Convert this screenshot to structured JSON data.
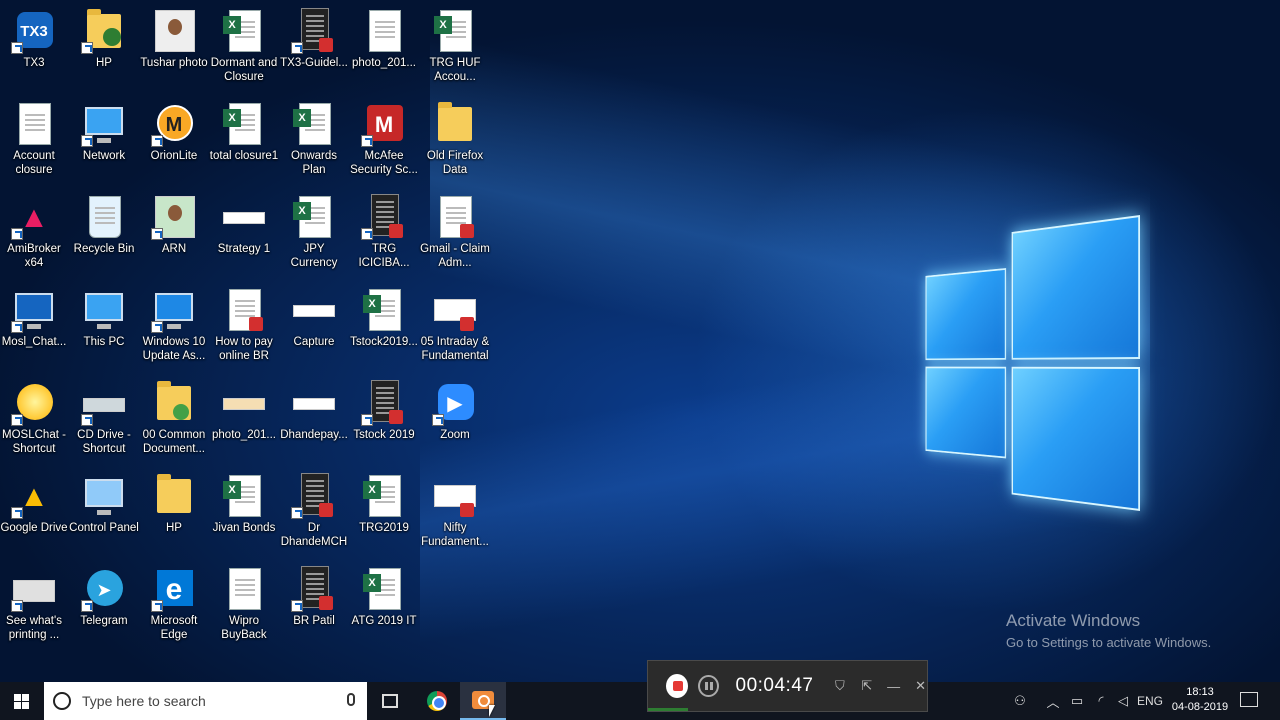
{
  "desktop": {
    "icons": [
      {
        "label": "TX3",
        "kind": "tx3"
      },
      {
        "label": "HP",
        "kind": "folder-user"
      },
      {
        "label": "Tushar photo",
        "kind": "photo"
      },
      {
        "label": "Dormant and Closure",
        "kind": "excel"
      },
      {
        "label": "TX3-Guidel...",
        "kind": "dark-pdf"
      },
      {
        "label": "photo_201...",
        "kind": "doc"
      },
      {
        "label": "TRG HUF Accou...",
        "kind": "excel"
      },
      {
        "label": "Account closure",
        "kind": "word"
      },
      {
        "label": "Network",
        "kind": "network"
      },
      {
        "label": "OrionLite",
        "kind": "orion"
      },
      {
        "label": "total closure1",
        "kind": "excel"
      },
      {
        "label": "Onwards Plan",
        "kind": "excel"
      },
      {
        "label": "McAfee Security Sc...",
        "kind": "mcafee"
      },
      {
        "label": "Old Firefox Data",
        "kind": "folder"
      },
      {
        "label": "AmiBroker x64",
        "kind": "amibroker"
      },
      {
        "label": "Recycle Bin",
        "kind": "recycle"
      },
      {
        "label": "ARN",
        "kind": "photo-green"
      },
      {
        "label": "Strategy 1",
        "kind": "strip"
      },
      {
        "label": "JPY Currency",
        "kind": "excel"
      },
      {
        "label": "TRG ICICIBA...",
        "kind": "dark-pdf"
      },
      {
        "label": "Gmail - Claim Adm...",
        "kind": "doc-pdf"
      },
      {
        "label": "Mosl_Chat...",
        "kind": "mosl"
      },
      {
        "label": "This PC",
        "kind": "pc"
      },
      {
        "label": "Windows 10 Update As...",
        "kind": "win-update"
      },
      {
        "label": "How to pay online BR",
        "kind": "doc-pdf"
      },
      {
        "label": "Capture",
        "kind": "strip"
      },
      {
        "label": "Tstock2019...",
        "kind": "excel"
      },
      {
        "label": "05 Intraday & Fundamental",
        "kind": "pdf-wide"
      },
      {
        "label": "MOSLChat - Shortcut",
        "kind": "sun"
      },
      {
        "label": "CD Drive - Shortcut",
        "kind": "drive"
      },
      {
        "label": "00 Common Document...",
        "kind": "folder-green"
      },
      {
        "label": "photo_201...",
        "kind": "strip-tan"
      },
      {
        "label": "Dhandepay...",
        "kind": "strip"
      },
      {
        "label": "Tstock 2019",
        "kind": "dark-pdf"
      },
      {
        "label": "Zoom",
        "kind": "zoom"
      },
      {
        "label": "Google Drive",
        "kind": "gdrive"
      },
      {
        "label": "Control Panel",
        "kind": "control"
      },
      {
        "label": "HP",
        "kind": "folder"
      },
      {
        "label": "Jivan Bonds",
        "kind": "excel"
      },
      {
        "label": "Dr DhandeMCH",
        "kind": "dark-pdf"
      },
      {
        "label": "TRG2019",
        "kind": "excel"
      },
      {
        "label": "Nifty Fundament...",
        "kind": "pdf-wide"
      },
      {
        "label": "See what's printing ...",
        "kind": "printer"
      },
      {
        "label": "Telegram",
        "kind": "telegram"
      },
      {
        "label": "Microsoft Edge",
        "kind": "edge"
      },
      {
        "label": "Wipro BuyBack",
        "kind": "word"
      },
      {
        "label": "BR Patil",
        "kind": "dark-pdf"
      },
      {
        "label": "ATG 2019 IT",
        "kind": "excel"
      }
    ]
  },
  "watermark": {
    "title": "Activate Windows",
    "subtitle": "Go to Settings to activate Windows."
  },
  "recorder": {
    "timer": "00:04:47"
  },
  "taskbar": {
    "search_placeholder": "Type here to search",
    "language": "ENG",
    "time": "18:13",
    "date": "04-08-2019"
  },
  "colors": {
    "taskbar_bg": "#10151f",
    "accent": "#76b9ed",
    "record_red": "#e53935"
  }
}
